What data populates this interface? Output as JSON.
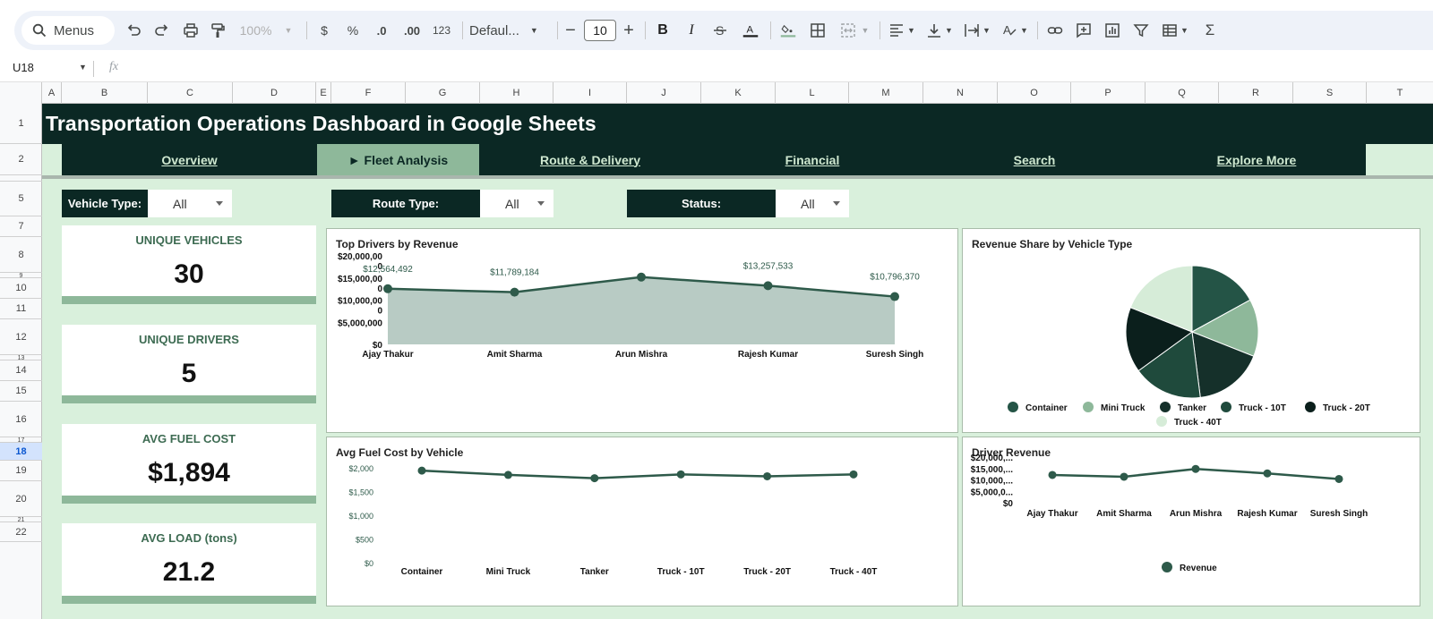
{
  "toolbar": {
    "menus_label": "Menus",
    "zoom": "100%",
    "currency": "$",
    "percent": "%",
    "dec_decrease": ".0",
    "dec_increase": ".00",
    "number_format": "123",
    "font_family": "Defaul...",
    "font_size": "10",
    "bold": "B",
    "italic": "I"
  },
  "formula_bar": {
    "cell_ref": "U18",
    "fx": "fx",
    "value": ""
  },
  "columns": [
    "A",
    "B",
    "C",
    "D",
    "E",
    "F",
    "G",
    "H",
    "I",
    "J",
    "K",
    "L",
    "M",
    "N",
    "O",
    "P",
    "Q",
    "R",
    "S",
    "T"
  ],
  "rows": [
    "1",
    "2",
    "5",
    "7",
    "8",
    "9",
    "10",
    "11",
    "12",
    "13",
    "14",
    "15",
    "16",
    "17",
    "18",
    "19",
    "20",
    "21",
    "22"
  ],
  "selected_row": "18",
  "page_title": "Transportation Operations Dashboard in Google Sheets",
  "nav": {
    "overview": "Overview",
    "fleet": "► Fleet Analysis",
    "route": "Route & Delivery",
    "financial": "Financial",
    "search": "Search",
    "explore": "Explore More"
  },
  "filters": {
    "vehicle_label": "Vehicle Type:",
    "vehicle_value": "All",
    "route_label": "Route Type:",
    "route_value": "All",
    "status_label": "Status:",
    "status_value": "All"
  },
  "kpis": {
    "vehicles_label": "UNIQUE VEHICLES",
    "vehicles_value": "30",
    "drivers_label": "UNIQUE DRIVERS",
    "drivers_value": "5",
    "fuel_label": "AVG FUEL COST",
    "fuel_value": "$1,894",
    "load_label": "AVG LOAD (tons)",
    "load_value": "21.2"
  },
  "colors": {
    "dark": "#0b2824",
    "accent": "#8eb89a",
    "sheet_bg": "#d9f0dc",
    "series": "#2e5a4a",
    "area_fill": "#b8cbc4"
  },
  "chart_data": [
    {
      "id": "top_drivers",
      "type": "area",
      "title": "Top Drivers by Revenue",
      "categories": [
        "Ajay Thakur",
        "Amit Sharma",
        "Arun Mishra",
        "Rajesh Kumar",
        "Suresh Singh"
      ],
      "values": [
        12564492,
        11789184,
        15200000,
        13257533,
        10796370
      ],
      "data_labels": [
        "$12,564,492",
        "$11,789,184",
        "",
        "$13,257,533",
        "$10,796,370"
      ],
      "y_ticks": [
        "$20,000,00\n0",
        "$15,000,00\n0",
        "$10,000,00\n0",
        "$5,000,000",
        "$0"
      ],
      "ylim": [
        0,
        20000000
      ]
    },
    {
      "id": "revenue_share",
      "type": "pie",
      "title": "Revenue Share by Vehicle Type",
      "labels": [
        "Container",
        "Mini Truck",
        "Tanker",
        "Truck - 10T",
        "Truck - 20T",
        "Truck - 40T"
      ],
      "values": [
        17.0,
        14.0,
        17.0,
        17.0,
        16.0,
        19.0
      ],
      "colors": [
        "#245446",
        "#8eb89a",
        "#15302a",
        "#1f4a3c",
        "#0b1f1c",
        "#d6ecd8"
      ]
    },
    {
      "id": "fuel_cost",
      "type": "line",
      "title": "Avg Fuel Cost by Vehicle",
      "categories": [
        "Container",
        "Mini Truck",
        "Tanker",
        "Truck - 10T",
        "Truck - 20T",
        "Truck - 40T"
      ],
      "values": [
        1960,
        1870,
        1800,
        1880,
        1840,
        1880
      ],
      "y_ticks": [
        "$2,000",
        "$1,500",
        "$1,000",
        "$500",
        "$0"
      ],
      "ylim": [
        0,
        2000
      ]
    },
    {
      "id": "driver_revenue",
      "type": "line",
      "title": "Driver  Revenue",
      "categories": [
        "Ajay Thakur",
        "Amit Sharma",
        "Arun Mishra",
        "Rajesh Kumar",
        "Suresh Singh"
      ],
      "series": [
        {
          "name": "Revenue",
          "values": [
            12564492,
            11789184,
            15200000,
            13257533,
            10796370
          ]
        }
      ],
      "y_ticks": [
        "$20,000,...",
        "$15,000,...",
        "$10,000,...",
        "$5,000,0...",
        "$0"
      ],
      "ylim": [
        0,
        20000000
      ]
    }
  ]
}
